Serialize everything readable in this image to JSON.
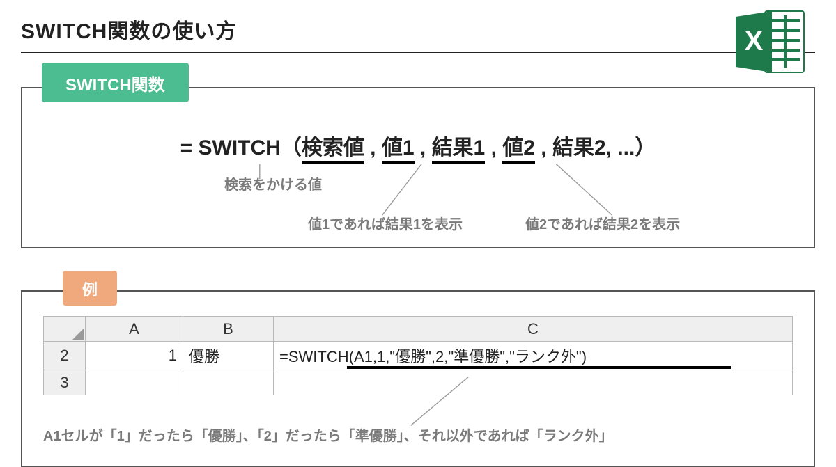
{
  "title": "SWITCH関数の使い方",
  "section1": {
    "badge": "SWITCH関数",
    "syntax_prefix": "= SWITCH（",
    "arg1": "検索値",
    "sep": " , ",
    "arg2": "値1",
    "arg3": "結果1",
    "arg4": "値2",
    "arg5": "結果2, ...",
    "syntax_suffix": "）",
    "annot1": "検索をかける値",
    "annot2": "値1であれば結果1を表示",
    "annot3": "値2であれば結果2を表示"
  },
  "section2": {
    "badge": "例",
    "columns": {
      "a": "A",
      "b": "B",
      "c": "C"
    },
    "rows": {
      "r2": {
        "hdr": "2",
        "a": "1",
        "b": "優勝",
        "c": "=SWITCH(A1,1,\"優勝\",2,\"準優勝\",\"ランク外\")"
      },
      "r3": {
        "hdr": "3"
      }
    },
    "annot": "A1セルが「1」だったら「優勝」、「2」だったら「準優勝」、それ以外であれば「ランク外」"
  }
}
